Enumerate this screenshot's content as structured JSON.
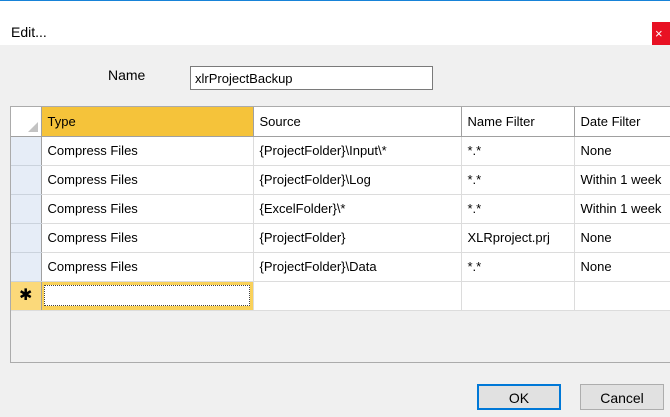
{
  "window": {
    "title": "Edit...",
    "close_glyph": "×",
    "close_icon": "close-icon"
  },
  "form": {
    "name_label": "Name",
    "name_value": "xlrProjectBackup"
  },
  "grid": {
    "columns": [
      "Type",
      "Source",
      "Name Filter",
      "Date Filter"
    ],
    "rows": [
      [
        "Compress Files",
        "{ProjectFolder}\\Input\\*",
        "*.*",
        "None"
      ],
      [
        "Compress Files",
        "{ProjectFolder}\\Log",
        "*.*",
        "Within 1 week"
      ],
      [
        "Compress Files",
        "{ExcelFolder}\\*",
        "*.*",
        "Within 1 week"
      ],
      [
        "Compress Files",
        "{ProjectFolder}",
        "XLRproject.prj",
        "None"
      ],
      [
        "Compress Files",
        "{ProjectFolder}\\Data",
        "*.*",
        "None"
      ]
    ],
    "new_row_glyph": "✱",
    "ellipsis_label": "...",
    "selected_header_color": "#f5c33a"
  },
  "buttons": {
    "ok": "OK",
    "cancel": "Cancel"
  }
}
